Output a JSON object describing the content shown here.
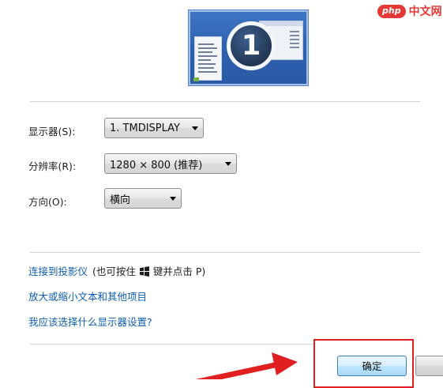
{
  "preview": {
    "monitor_number": "1"
  },
  "watermark": {
    "badge": "php",
    "site": "中文网"
  },
  "settings": {
    "display_label": "显示器(S):",
    "display_value": "1. TMDISPLAY",
    "resolution_label": "分辨率(R):",
    "resolution_value": "1280 × 800 (推荐)",
    "orientation_label": "方向(O):",
    "orientation_value": "横向"
  },
  "links": {
    "projector": "连接到投影仪",
    "projector_hint_before": "(也可按住",
    "projector_hint_after": "键并点击 P)",
    "text_size": "放大或缩小文本和其他项目",
    "which_settings": "我应该选择什么显示器设置?"
  },
  "buttons": {
    "ok_label": "确定"
  },
  "colors": {
    "link": "#0d5eaf",
    "highlight": "#e02020",
    "watermark": "#e53935"
  },
  "icons": {
    "windows_key": "windows-logo-icon",
    "dropdown": "chevron-down-icon"
  }
}
